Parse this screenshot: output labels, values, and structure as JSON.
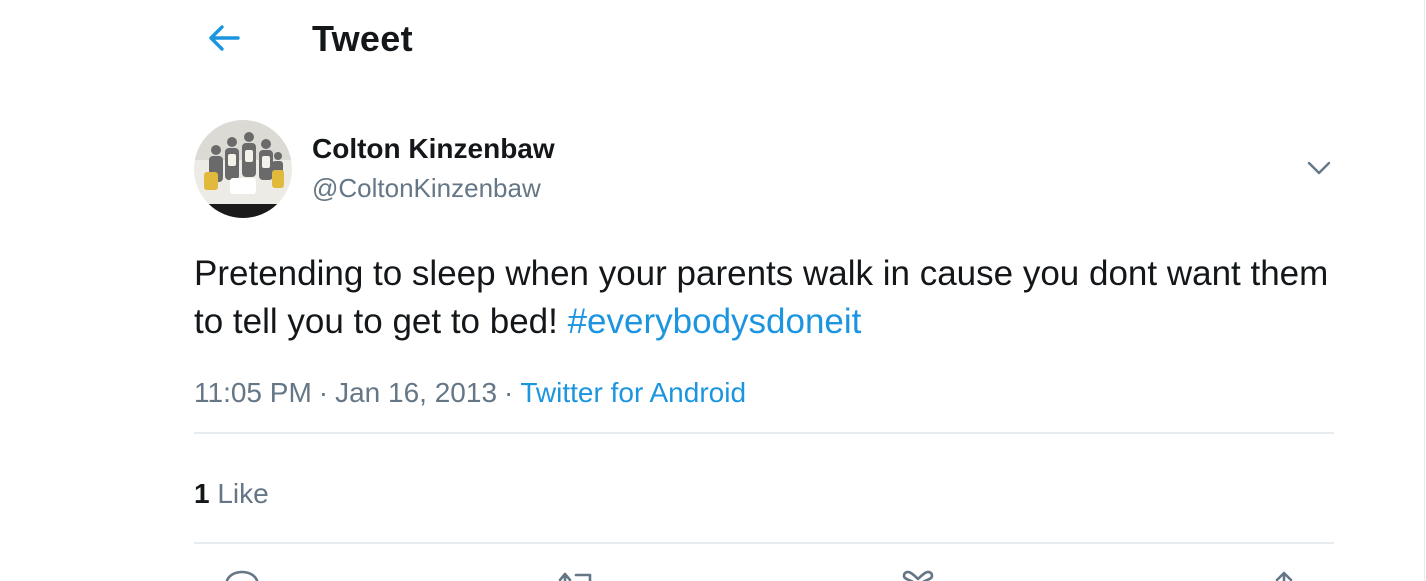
{
  "header": {
    "back_icon": "arrow-left-icon",
    "title": "Tweet"
  },
  "author": {
    "name": "Colton Kinzenbaw",
    "handle": "@ColtonKinzenbaw",
    "avatar_icon": "team-photo-avatar"
  },
  "tweet": {
    "text": "Pretending to sleep when your parents walk in cause you dont want them to tell you to get to bed! ",
    "hashtag": "#everybodysdoneit",
    "time": "11:05 PM",
    "separator": "·",
    "date": "Jan 16, 2013",
    "source": "Twitter for Android"
  },
  "stats": {
    "likes_count": "1",
    "likes_label": "Like"
  },
  "actions": [
    "reply-icon",
    "retweet-icon",
    "like-icon",
    "share-icon"
  ],
  "colors": {
    "accent": "#1b95e0",
    "text": "#14171a",
    "secondary": "#657786",
    "divider": "#e6ecf0"
  }
}
